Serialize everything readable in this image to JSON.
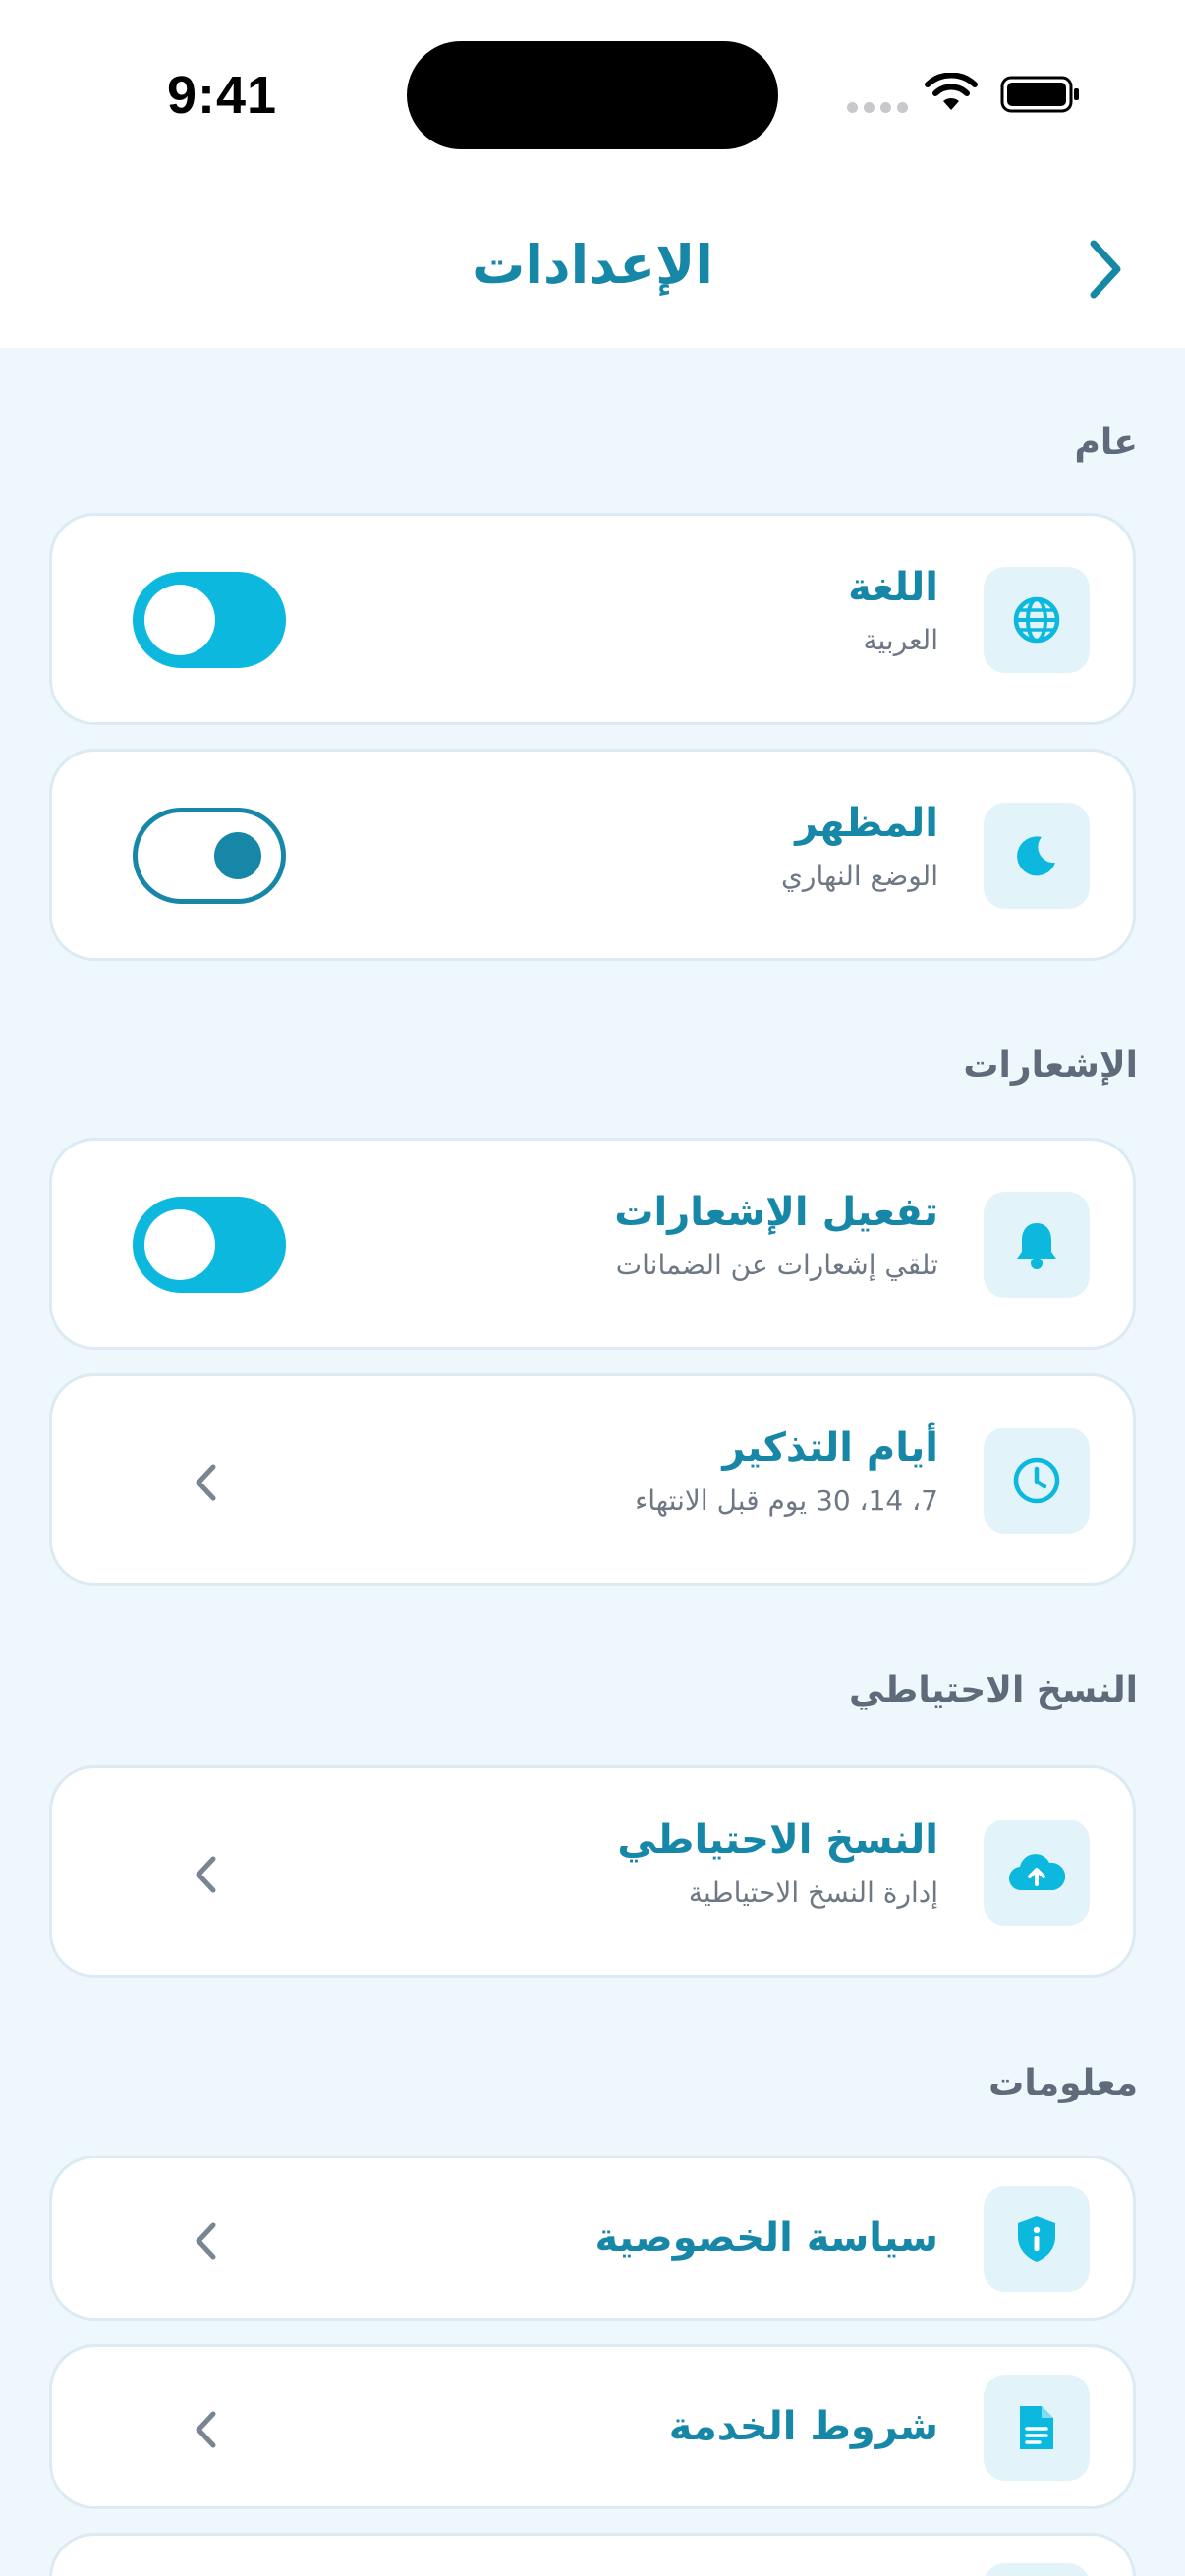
{
  "status_bar": {
    "time": "9:41"
  },
  "header": {
    "title": "الإعدادات",
    "back_icon": "chevron-right-icon"
  },
  "sections": {
    "general": {
      "title": "عام",
      "language": {
        "label": "اللغة",
        "value": "العربية",
        "icon": "globe-icon",
        "toggle_on": true
      },
      "appearance": {
        "label": "المظهر",
        "value": "الوضع النهاري",
        "icon": "moon-icon",
        "toggle_on": true
      }
    },
    "notifications": {
      "title": "الإشعارات",
      "enable": {
        "label": "تفعيل الإشعارات",
        "value": "تلقي إشعارات عن الضمانات",
        "icon": "bell-icon",
        "toggle_on": true
      },
      "reminder_days": {
        "label": "أيام التذكير",
        "value": "7، 14، 30 يوم قبل الانتهاء",
        "icon": "clock-icon"
      }
    },
    "backup": {
      "title": "النسخ الاحتياطي",
      "backup_item": {
        "label": "النسخ الاحتياطي",
        "value": "إدارة النسخ الاحتياطية",
        "icon": "cloud-upload-icon"
      }
    },
    "info": {
      "title": "معلومات",
      "privacy": {
        "label": "سياسة الخصوصية",
        "icon": "shield-info-icon"
      },
      "terms": {
        "label": "شروط الخدمة",
        "icon": "document-icon"
      }
    }
  },
  "colors": {
    "accent": "#1787A8",
    "toggle_on": "#0DB8DE",
    "icon_bg": "#E2F4FA",
    "page_bg": "#EEF7FC"
  }
}
